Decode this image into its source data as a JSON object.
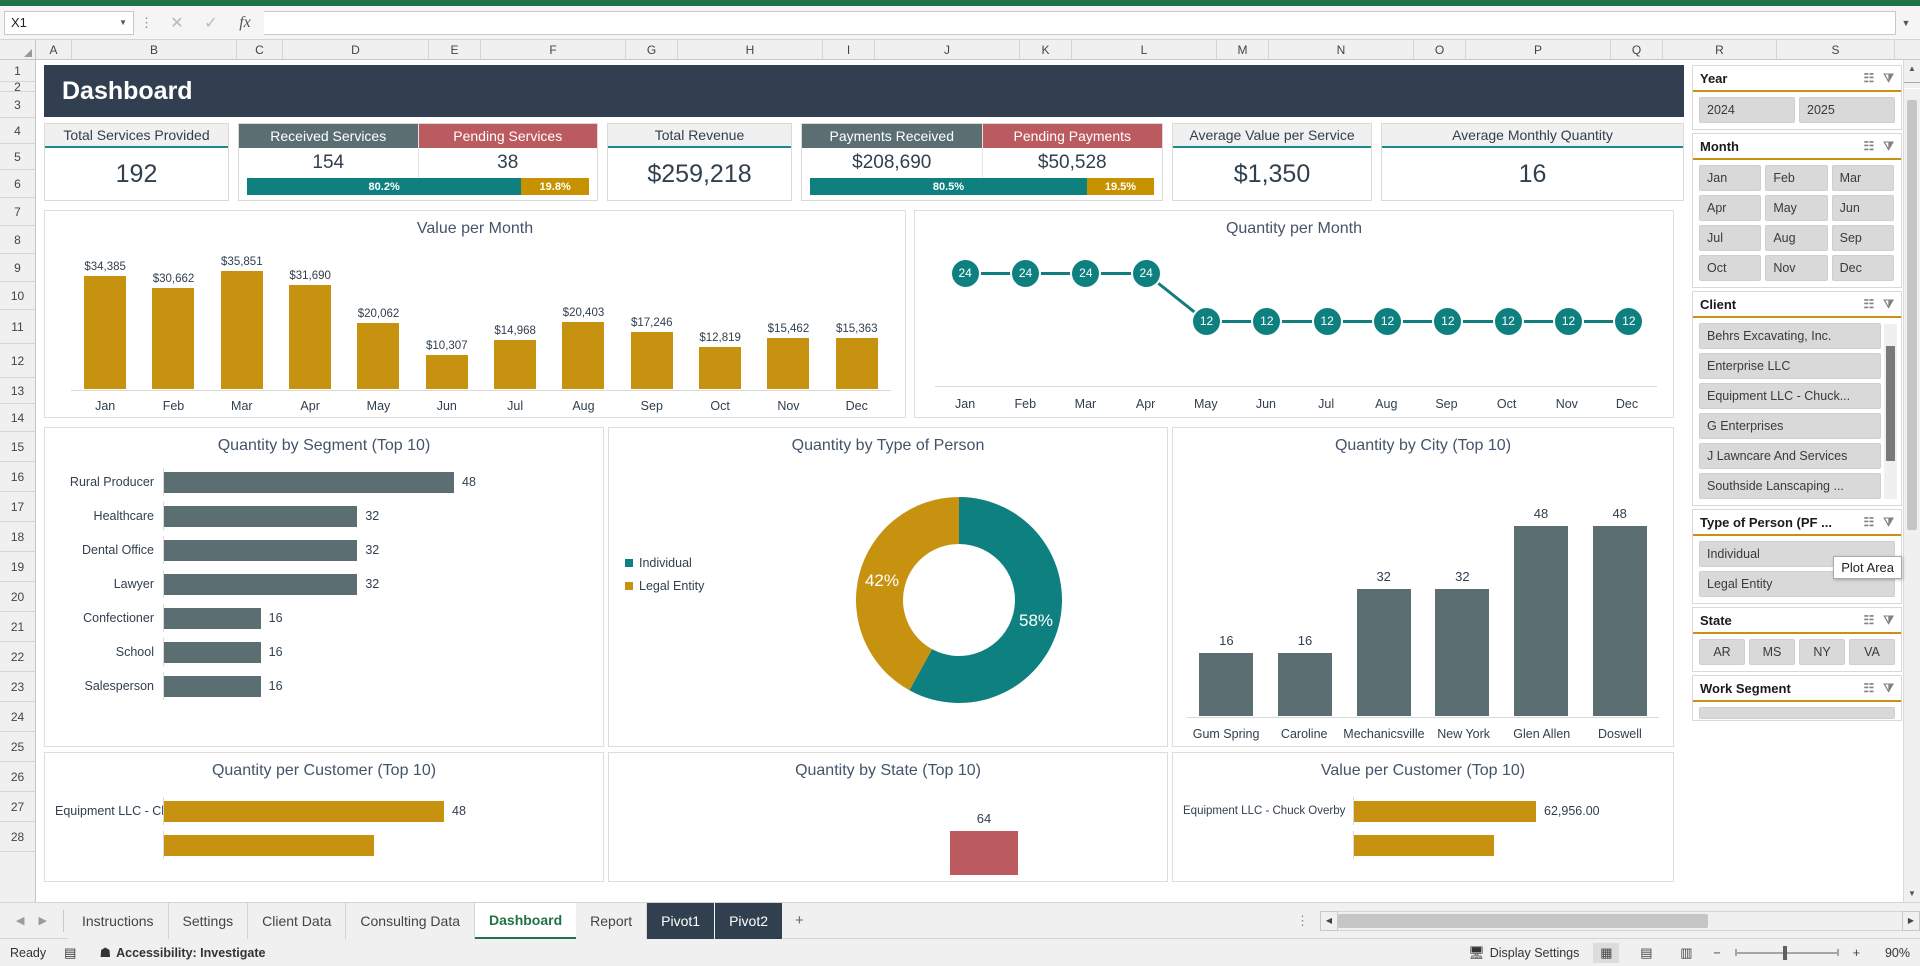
{
  "app": {
    "namebox_value": "X1",
    "formula_value": "",
    "accept_icon": "check-icon",
    "cancel_icon": "close-icon",
    "fx_label": "fx"
  },
  "columns": [
    "A",
    "B",
    "C",
    "D",
    "E",
    "F",
    "G",
    "H",
    "I",
    "J",
    "K",
    "L",
    "M",
    "N",
    "O",
    "P",
    "Q",
    "R",
    "S"
  ],
  "rows": [
    "1",
    "2",
    "3",
    "4",
    "5",
    "6",
    "7",
    "8",
    "9",
    "10",
    "11",
    "12",
    "13",
    "14",
    "15",
    "16",
    "17",
    "18",
    "19",
    "20",
    "21",
    "22",
    "23",
    "24",
    "25",
    "26",
    "27",
    "28"
  ],
  "banner": {
    "title": "Dashboard"
  },
  "kpis": [
    {
      "label": "Total Services Provided",
      "value": "192",
      "style": "plain"
    },
    {
      "label": "Total Revenue",
      "value": "$259,218",
      "style": "plain"
    },
    {
      "label": "Average Value per Service",
      "value": "$1,350",
      "style": "plain"
    },
    {
      "label": "Average Monthly Quantity",
      "value": "16",
      "style": "plain"
    }
  ],
  "kpi_pairs": [
    {
      "left_label": "Received Services",
      "left_value": "154",
      "left_pct": "80.2%",
      "right_label": "Pending Services",
      "right_value": "38",
      "right_pct": "19.8%",
      "left_pct_num": 80.2,
      "right_pct_num": 19.8
    },
    {
      "left_label": "Payments Received",
      "left_value": "$208,690",
      "left_pct": "80.5%",
      "right_label": "Pending Payments",
      "right_value": "$50,528",
      "right_pct": "19.5%",
      "left_pct_num": 80.5,
      "right_pct_num": 19.5
    }
  ],
  "chart_data": [
    {
      "type": "bar",
      "title": "Value per Month",
      "categories": [
        "Jan",
        "Feb",
        "Mar",
        "Apr",
        "May",
        "Jun",
        "Jul",
        "Aug",
        "Sep",
        "Oct",
        "Nov",
        "Dec"
      ],
      "values": [
        34385,
        30662,
        35851,
        31690,
        20062,
        10307,
        14968,
        20403,
        17246,
        12819,
        15462,
        15363
      ],
      "labels": [
        "$34,385",
        "$30,662",
        "$35,851",
        "$31,690",
        "$20,062",
        "$10,307",
        "$14,968",
        "$20,403",
        "$17,246",
        "$12,819",
        "$15,462",
        "$15,363"
      ],
      "xlabel": "",
      "ylabel": "",
      "ylim": [
        0,
        35851
      ],
      "grid": false,
      "color": "#c89211"
    },
    {
      "type": "line",
      "title": "Quantity per Month",
      "categories": [
        "Jan",
        "Feb",
        "Mar",
        "Apr",
        "May",
        "Jun",
        "Jul",
        "Aug",
        "Sep",
        "Oct",
        "Nov",
        "Dec"
      ],
      "values": [
        24,
        24,
        24,
        24,
        12,
        12,
        12,
        12,
        12,
        12,
        12,
        12
      ],
      "labels": [
        "24",
        "24",
        "24",
        "24",
        "12",
        "12",
        "12",
        "12",
        "12",
        "12",
        "12",
        "12"
      ],
      "xlabel": "",
      "ylabel": "",
      "ylim": [
        0,
        24
      ],
      "grid": false,
      "color": "#0f8080"
    },
    {
      "type": "bar",
      "orientation": "horizontal",
      "title": "Quantity by Segment (Top 10)",
      "categories": [
        "Rural Producer",
        "Healthcare",
        "Dental Office",
        "Lawyer",
        "Confectioner",
        "School",
        "Salesperson"
      ],
      "values": [
        48,
        32,
        32,
        32,
        16,
        16,
        16
      ],
      "labels": [
        "48",
        "32",
        "32",
        "32",
        "16",
        "16",
        "16"
      ],
      "ylim": [
        0,
        48
      ],
      "color": "#5b6f72"
    },
    {
      "type": "pie",
      "title": "Quantity by Type of Person",
      "categories": [
        "Individual",
        "Legal Entity"
      ],
      "values": [
        58,
        42
      ],
      "labels": [
        "58%",
        "42%"
      ],
      "legend_position": "left",
      "colors": [
        "#0f8080",
        "#c89211"
      ]
    },
    {
      "type": "bar",
      "title": "Quantity by City (Top 10)",
      "categories": [
        "Gum Spring",
        "Caroline",
        "Mechanicsville",
        "New York",
        "Glen Allen",
        "Doswell"
      ],
      "values": [
        16,
        16,
        32,
        32,
        48,
        48
      ],
      "labels": [
        "16",
        "16",
        "32",
        "32",
        "48",
        "48"
      ],
      "ylim": [
        0,
        48
      ],
      "color": "#5b6f72"
    },
    {
      "type": "bar",
      "orientation": "horizontal",
      "title": "Quantity per Customer (Top 10)",
      "categories": [
        "Equipment LLC - Chuck Overby"
      ],
      "values": [
        48
      ],
      "labels": [
        "48"
      ],
      "ylim": [
        0,
        48
      ],
      "color": "#c89211"
    },
    {
      "type": "bar",
      "title": "Quantity by State (Top 10)",
      "categories": [
        ""
      ],
      "values": [
        64
      ],
      "labels": [
        "64"
      ],
      "ylim": [
        0,
        64
      ],
      "color": "#bb5a5f"
    },
    {
      "type": "bar",
      "orientation": "horizontal",
      "title": "Value per Customer (Top 10)",
      "categories": [
        "Equipment LLC - Chuck Overby"
      ],
      "values": [
        62956
      ],
      "labels": [
        "62,956.00"
      ],
      "ylim": [
        0,
        62956
      ],
      "color": "#c89211"
    }
  ],
  "slicers": [
    {
      "title": "Year",
      "items": [
        "2024",
        "2025"
      ],
      "cols": 2
    },
    {
      "title": "Month",
      "items": [
        "Jan",
        "Feb",
        "Mar",
        "Apr",
        "May",
        "Jun",
        "Jul",
        "Aug",
        "Sep",
        "Oct",
        "Nov",
        "Dec"
      ],
      "cols": 3
    },
    {
      "title": "Client",
      "items": [
        "Behrs Excavating, Inc.",
        "Enterprise LLC",
        "Equipment LLC - Chuck...",
        "G Enterprises",
        "J Lawncare And Services",
        "Southside Lanscaping ..."
      ],
      "cols": 1
    },
    {
      "title": "Type of Person (PF ...",
      "items": [
        "Individual",
        "Legal Entity"
      ],
      "cols": 1
    },
    {
      "title": "State",
      "items": [
        "AR",
        "MS",
        "NY",
        "VA"
      ],
      "cols": 4
    },
    {
      "title": "Work Segment",
      "items": [
        ""
      ],
      "cols": 1
    }
  ],
  "tooltip": {
    "text": "Plot Area"
  },
  "tabs": [
    {
      "label": "Instructions",
      "state": "normal"
    },
    {
      "label": "Settings",
      "state": "normal"
    },
    {
      "label": "Client Data",
      "state": "normal"
    },
    {
      "label": "Consulting Data",
      "state": "normal"
    },
    {
      "label": "Dashboard",
      "state": "active"
    },
    {
      "label": "Report",
      "state": "normal"
    },
    {
      "label": "Pivot1",
      "state": "pivot"
    },
    {
      "label": "Pivot2",
      "state": "pivot"
    }
  ],
  "add_sheet": "+",
  "status": {
    "ready": "Ready",
    "accessibility": "Accessibility: Investigate",
    "display_settings": "Display Settings",
    "zoom": "90%"
  }
}
